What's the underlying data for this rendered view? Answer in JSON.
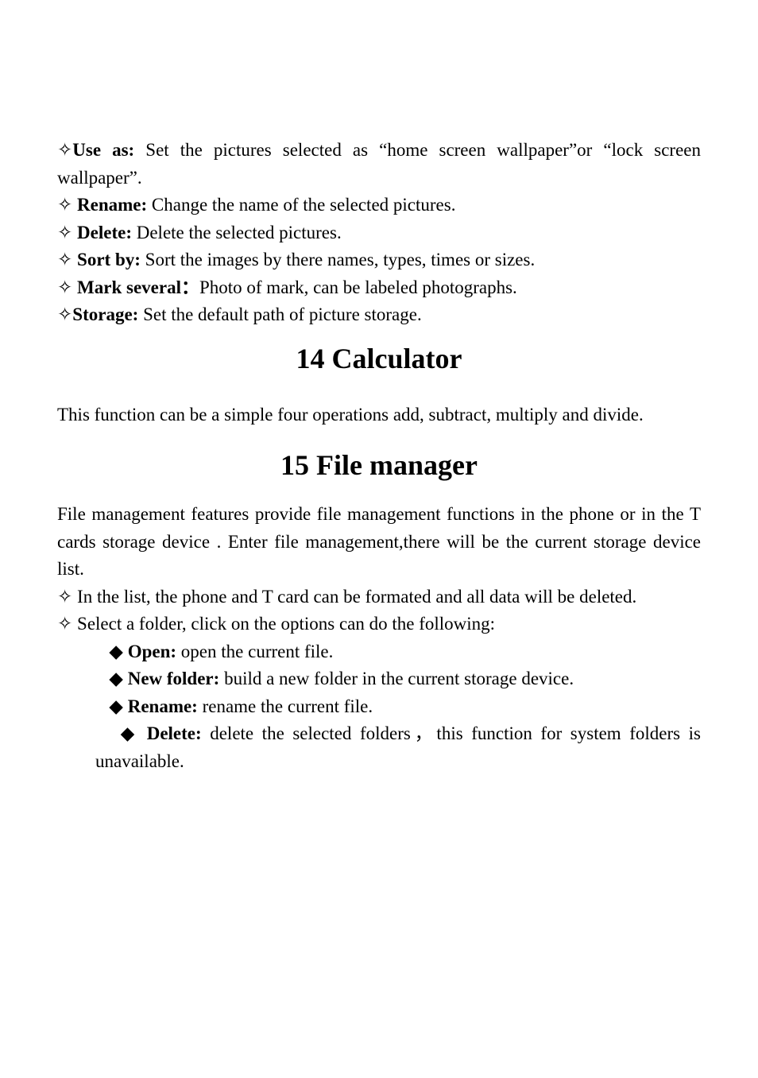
{
  "glyphs": {
    "diamond_open": "✧",
    "diamond_solid": "◆"
  },
  "items": {
    "use_as": {
      "label": "Use as:",
      "text": " Set the pictures selected as “home screen wallpaper”or “lock screen wallpaper”."
    },
    "rename": {
      "label": " Rename:",
      "text": " Change the name of the selected pictures."
    },
    "delete": {
      "label": " Delete:",
      "text": " Delete the selected pictures."
    },
    "sort_by": {
      "label": " Sort by:",
      "text": " Sort the images by there names, types, times or sizes."
    },
    "mark_several": {
      "label": " Mark several：",
      "text": "Photo of mark, can be labeled photographs."
    },
    "storage": {
      "label": "Storage:",
      "text": " Set the default path of picture storage."
    }
  },
  "section14": {
    "heading": "14 Calculator",
    "body": "This function can be a simple four operations add, subtract, multiply and divide."
  },
  "section15": {
    "heading": "15 File manager",
    "intro": "File management features provide file management functions in the phone or in the T cards storage device . Enter file management,there will be the current storage device list.",
    "bullet1": " In the list, the phone and T card can be formated and all data will be deleted.",
    "bullet2": " Select a folder, click on the options can do the following:",
    "sub": {
      "open": {
        "label": " Open:",
        "text": " open the current file."
      },
      "new_folder": {
        "label": " New folder:",
        "text": " build a new folder in the current  storage device."
      },
      "rename": {
        "label": " Rename:",
        "text": " rename the current file."
      },
      "delete": {
        "label": " Delete:",
        "text": " delete the selected folders，this function for system folders is unavailable."
      }
    }
  }
}
